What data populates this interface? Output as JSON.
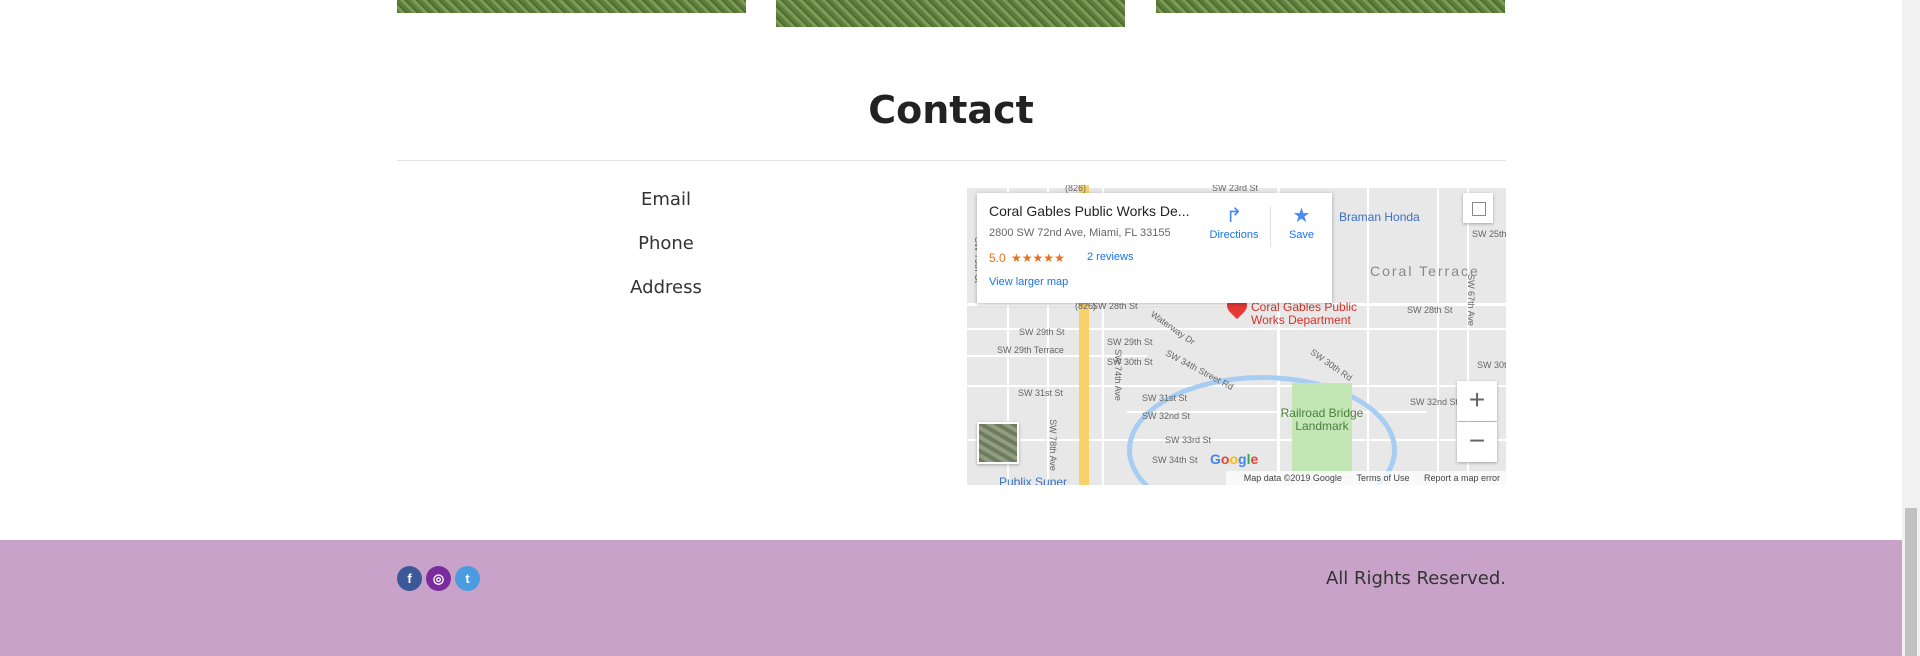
{
  "contact": {
    "title": "Contact",
    "labels": [
      "Email",
      "Phone",
      "Address"
    ]
  },
  "map": {
    "place_name": "Coral Gables Public Works De...",
    "address": "2800 SW 72nd Ave, Miami, FL 33155",
    "rating": "5.0",
    "stars": "★★★★★",
    "reviews": "2 reviews",
    "directions": "Directions",
    "save": "Save",
    "larger_map": "View larger map",
    "pin_label": "Coral Gables Public Works Department",
    "landmark": "Railroad Bridge Landmark",
    "area": "Coral Terrace",
    "business": "Braman Honda",
    "business2": "Publix Super",
    "streets": [
      "SW 23rd St",
      "SW 25th",
      "SW 28th St",
      "SW 29th St",
      "SW 29th Terrace",
      "SW 30th St",
      "SW 31st St",
      "SW 32nd St",
      "SW 33rd St",
      "SW 34th St",
      "SW 34th Street Rd",
      "SW 30th Rd",
      "SW 67th Ave",
      "SW 32nd St",
      "SW 30th",
      "Waterway Dr",
      "SW 74th Ave",
      "SW 79th Ct",
      "SW 78th Ave",
      "(826)"
    ],
    "zoom_in": "+",
    "zoom_out": "−",
    "google": "Google",
    "map_data": "Map data ©2019 Google",
    "terms": "Terms of Use",
    "report": "Report a map error"
  },
  "footer": {
    "rights": "All Rights Reserved.",
    "social": [
      "facebook-icon",
      "instagram-icon",
      "twitter-icon"
    ],
    "social_glyphs": [
      "f",
      "◎",
      "t"
    ],
    "bg_color": "#c8a2c8"
  }
}
